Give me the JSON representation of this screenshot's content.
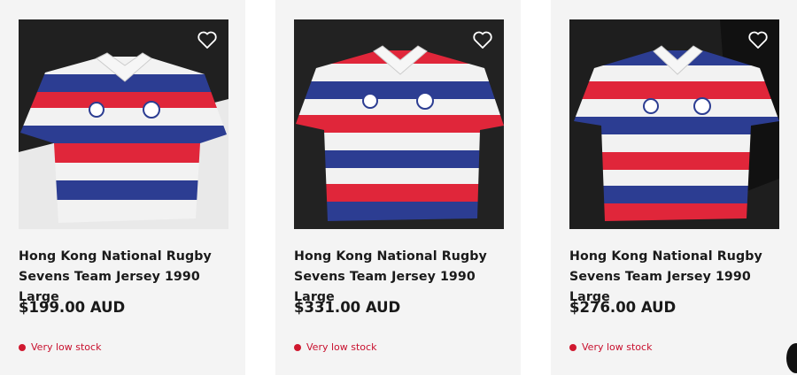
{
  "products": [
    {
      "title": "Hong Kong National Rugby Sevens Team Jersey 1990 Large",
      "price": "$199.00 AUD",
      "stock": "Very low stock",
      "wishlist_icon": "heart-outline-icon"
    },
    {
      "title": "Hong Kong National Rugby Sevens Team Jersey 1990 Large",
      "price": "$331.00 AUD",
      "stock": "Very low stock",
      "wishlist_icon": "heart-outline-icon"
    },
    {
      "title": "Hong Kong National Rugby Sevens Team Jersey 1990 Large",
      "price": "$276.00 AUD",
      "stock": "Very low stock",
      "wishlist_icon": "heart-outline-icon"
    }
  ],
  "colors": {
    "stock_red": "#d0182f",
    "stripe_red": "#e0263a",
    "stripe_blue": "#2c3d92",
    "stripe_white": "#f2f2f2"
  }
}
